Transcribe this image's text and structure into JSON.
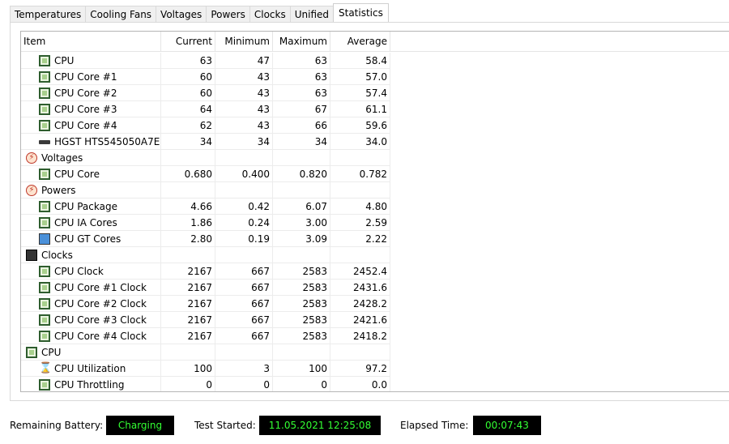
{
  "tabs": [
    "Temperatures",
    "Cooling Fans",
    "Voltages",
    "Powers",
    "Clocks",
    "Unified",
    "Statistics"
  ],
  "active_tab": "Statistics",
  "columns": [
    "Item",
    "Current",
    "Minimum",
    "Maximum",
    "Average"
  ],
  "rows": [
    {
      "level": 1,
      "icon": "cpu-chip-icon",
      "label": "CPU",
      "current": "63",
      "minimum": "47",
      "maximum": "63",
      "average": "58.4"
    },
    {
      "level": 1,
      "icon": "cpu-chip-icon",
      "label": "CPU Core #1",
      "current": "60",
      "minimum": "43",
      "maximum": "63",
      "average": "57.0"
    },
    {
      "level": 1,
      "icon": "cpu-chip-icon",
      "label": "CPU Core #2",
      "current": "60",
      "minimum": "43",
      "maximum": "63",
      "average": "57.4"
    },
    {
      "level": 1,
      "icon": "cpu-chip-icon",
      "label": "CPU Core #3",
      "current": "64",
      "minimum": "43",
      "maximum": "67",
      "average": "61.1"
    },
    {
      "level": 1,
      "icon": "cpu-chip-icon",
      "label": "CPU Core #4",
      "current": "62",
      "minimum": "43",
      "maximum": "66",
      "average": "59.6"
    },
    {
      "level": 1,
      "icon": "hard-disk-icon",
      "label": "HGST HTS545050A7E...",
      "current": "34",
      "minimum": "34",
      "maximum": "34",
      "average": "34.0"
    },
    {
      "level": 0,
      "icon": "voltage-bolt-icon",
      "label": "Voltages",
      "current": "",
      "minimum": "",
      "maximum": "",
      "average": ""
    },
    {
      "level": 1,
      "icon": "cpu-chip-icon",
      "label": "CPU Core",
      "current": "0.680",
      "minimum": "0.400",
      "maximum": "0.820",
      "average": "0.782"
    },
    {
      "level": 0,
      "icon": "power-bolt-icon",
      "label": "Powers",
      "current": "",
      "minimum": "",
      "maximum": "",
      "average": ""
    },
    {
      "level": 1,
      "icon": "cpu-chip-icon",
      "label": "CPU Package",
      "current": "4.66",
      "minimum": "0.42",
      "maximum": "6.07",
      "average": "4.80"
    },
    {
      "level": 1,
      "icon": "cpu-chip-icon",
      "label": "CPU IA Cores",
      "current": "1.86",
      "minimum": "0.24",
      "maximum": "3.00",
      "average": "2.59"
    },
    {
      "level": 1,
      "icon": "gpu-monitor-icon",
      "label": "CPU GT Cores",
      "current": "2.80",
      "minimum": "0.19",
      "maximum": "3.09",
      "average": "2.22"
    },
    {
      "level": 0,
      "icon": "clock-film-icon",
      "label": "Clocks",
      "current": "",
      "minimum": "",
      "maximum": "",
      "average": ""
    },
    {
      "level": 1,
      "icon": "cpu-chip-icon",
      "label": "CPU Clock",
      "current": "2167",
      "minimum": "667",
      "maximum": "2583",
      "average": "2452.4"
    },
    {
      "level": 1,
      "icon": "cpu-chip-icon",
      "label": "CPU Core #1 Clock",
      "current": "2167",
      "minimum": "667",
      "maximum": "2583",
      "average": "2431.6"
    },
    {
      "level": 1,
      "icon": "cpu-chip-icon",
      "label": "CPU Core #2 Clock",
      "current": "2167",
      "minimum": "667",
      "maximum": "2583",
      "average": "2428.2"
    },
    {
      "level": 1,
      "icon": "cpu-chip-icon",
      "label": "CPU Core #3 Clock",
      "current": "2167",
      "minimum": "667",
      "maximum": "2583",
      "average": "2421.6"
    },
    {
      "level": 1,
      "icon": "cpu-chip-icon",
      "label": "CPU Core #4 Clock",
      "current": "2167",
      "minimum": "667",
      "maximum": "2583",
      "average": "2418.2"
    },
    {
      "level": 0,
      "icon": "cpu-chip-icon",
      "label": "CPU",
      "current": "",
      "minimum": "",
      "maximum": "",
      "average": ""
    },
    {
      "level": 1,
      "icon": "hourglass-icon",
      "label": "CPU Utilization",
      "current": "100",
      "minimum": "3",
      "maximum": "100",
      "average": "97.2"
    },
    {
      "level": 1,
      "icon": "cpu-chip-icon",
      "label": "CPU Throttling",
      "current": "0",
      "minimum": "0",
      "maximum": "0",
      "average": "0.0"
    }
  ],
  "footer": {
    "battery_label": "Remaining Battery:",
    "battery_value": "Charging",
    "test_started_label": "Test Started:",
    "test_started_value": "11.05.2021 12:25:08",
    "elapsed_label": "Elapsed Time:",
    "elapsed_value": "00:07:43"
  },
  "colors": {
    "status_text": "#33ff33",
    "status_bg": "#000000",
    "chip_green": "#a8d08d"
  }
}
